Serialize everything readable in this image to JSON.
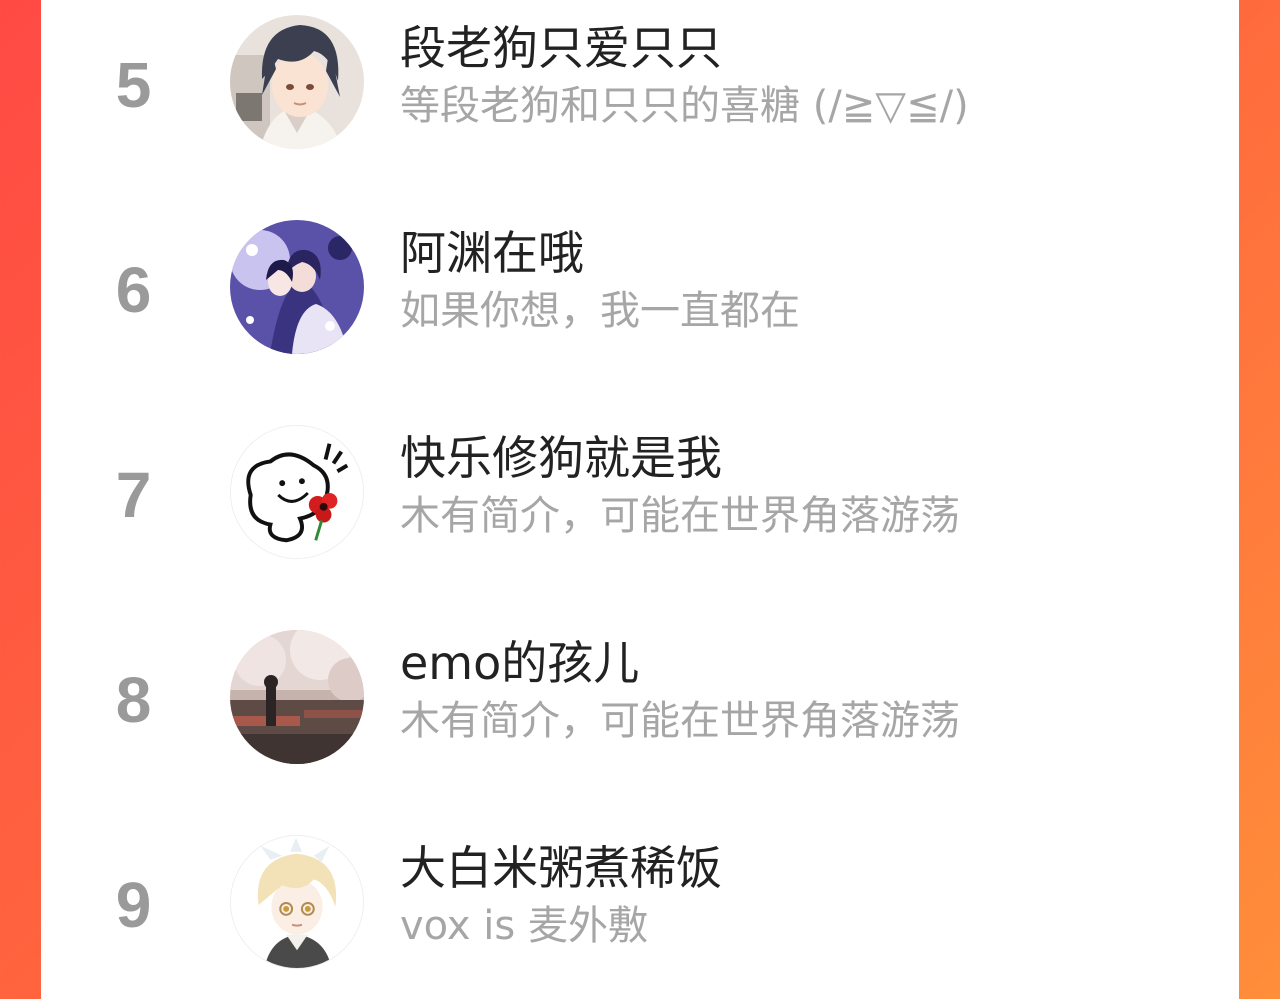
{
  "colors": {
    "background_gradient_start": "#ff4a44",
    "background_gradient_end": "#ff8e3a",
    "card": "#ffffff",
    "rank": "#9a9a9a",
    "name": "#222222",
    "bio": "#a6a6a6"
  },
  "leaderboard": {
    "entries": [
      {
        "rank": "5",
        "name": "段老狗只爱只只",
        "bio": "等段老狗和只只的喜糖 (/≧▽≦/)",
        "avatar_icon": "anime-boy-avatar"
      },
      {
        "rank": "6",
        "name": "阿渊在哦",
        "bio": "如果你想，我一直都在",
        "avatar_icon": "anime-couple-avatar"
      },
      {
        "rank": "7",
        "name": "快乐修狗就是我",
        "bio": "木有简介，可能在世界角落游荡",
        "avatar_icon": "doodle-flower-avatar"
      },
      {
        "rank": "8",
        "name": "emo的孩儿",
        "bio": "木有简介，可能在世界角落游荡",
        "avatar_icon": "cherry-blossom-avatar"
      },
      {
        "rank": "9",
        "name": "大白米粥煮稀饭",
        "bio": "vox is 麦外敷",
        "avatar_icon": "blond-anime-avatar"
      }
    ]
  }
}
